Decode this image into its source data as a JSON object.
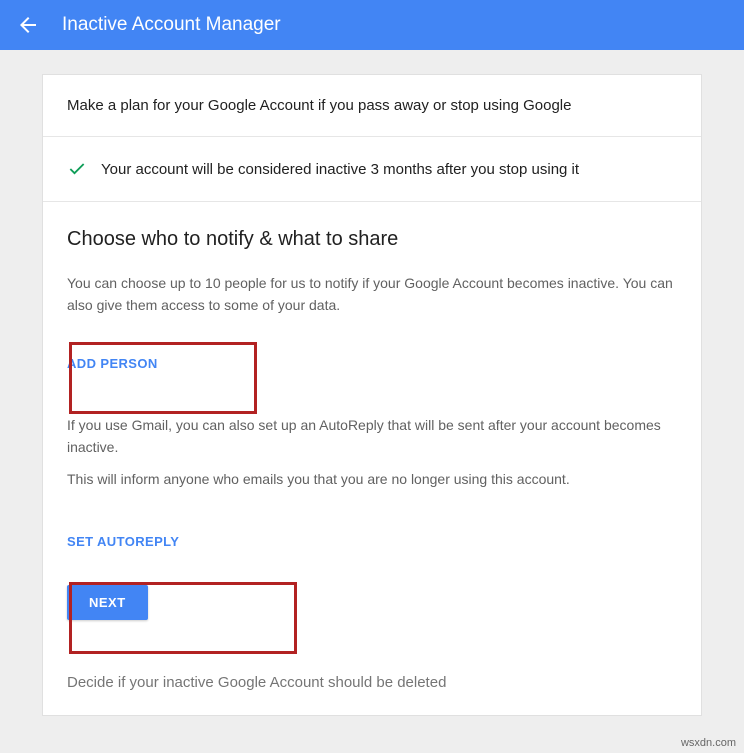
{
  "header": {
    "title": "Inactive Account Manager"
  },
  "intro": "Make a plan for your Google Account if you pass away or stop using Google",
  "status": "Your account will be considered inactive 3 months after you stop using it",
  "main": {
    "heading": "Choose who to notify & what to share",
    "notify_text": "You can choose up to 10 people for us to notify if your Google Account becomes inactive. You can also give them access to some of your data.",
    "add_person_label": "ADD PERSON",
    "autoreply_text1": "If you use Gmail, you can also set up an AutoReply that will be sent after your account becomes inactive.",
    "autoreply_text2": "This will inform anyone who emails you that you are no longer using this account.",
    "set_autoreply_label": "SET AUTOREPLY",
    "next_label": "NEXT"
  },
  "decide": "Decide if your inactive Google Account should be deleted",
  "watermark": "wsxdn.com"
}
